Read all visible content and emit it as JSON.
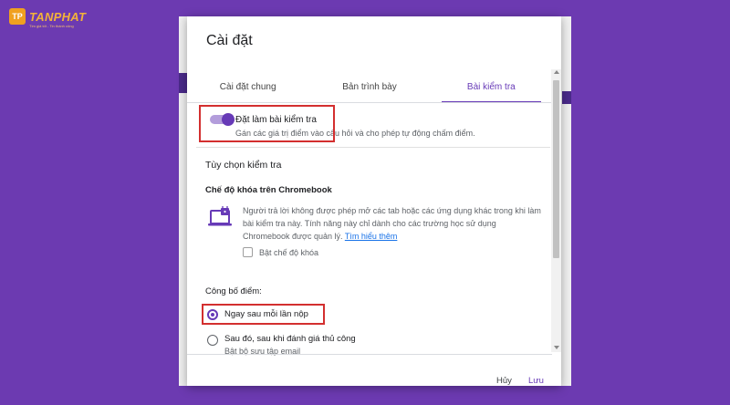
{
  "watermark": {
    "logo_mark": "TP",
    "brand": "TANPHAT",
    "tagline": "Tìm giá tốt - Tin thành công"
  },
  "dialog": {
    "title": "Cài đặt",
    "tabs": [
      {
        "label": "Cài đặt chung",
        "active": false
      },
      {
        "label": "Bản trình bày",
        "active": false
      },
      {
        "label": "Bài kiểm tra",
        "active": true
      }
    ]
  },
  "quiz": {
    "toggle_on": true,
    "label": "Đặt làm bài kiểm tra",
    "description": "Gán các giá trị điểm vào câu hỏi và cho phép tự động chấm điểm."
  },
  "options": {
    "section_title": "Tùy chọn kiểm tra",
    "chromebook": {
      "title": "Chế độ khóa trên Chromebook",
      "description": "Người trả lời không được phép mở các tab hoặc các ứng dụng khác trong khi làm bài kiểm tra này. Tính năng này chỉ dành cho các trường học sử dụng Chromebook được quản lý.",
      "learn_more": "Tìm hiểu thêm",
      "checkbox_label": "Bật chế độ khóa",
      "checked": false
    }
  },
  "publish": {
    "title": "Công bố điểm:",
    "options": [
      {
        "label": "Ngay sau mỗi lần nộp",
        "selected": true
      },
      {
        "label": "Sau đó, sau khi đánh giá thủ công",
        "sub": "Bật bộ sưu tập email",
        "selected": false
      }
    ]
  },
  "buttons": {
    "cancel": "Hủy",
    "save": "Lưu"
  },
  "colors": {
    "background": "#6c3ab1",
    "accent": "#673ab7",
    "highlight": "#d32f2f"
  }
}
